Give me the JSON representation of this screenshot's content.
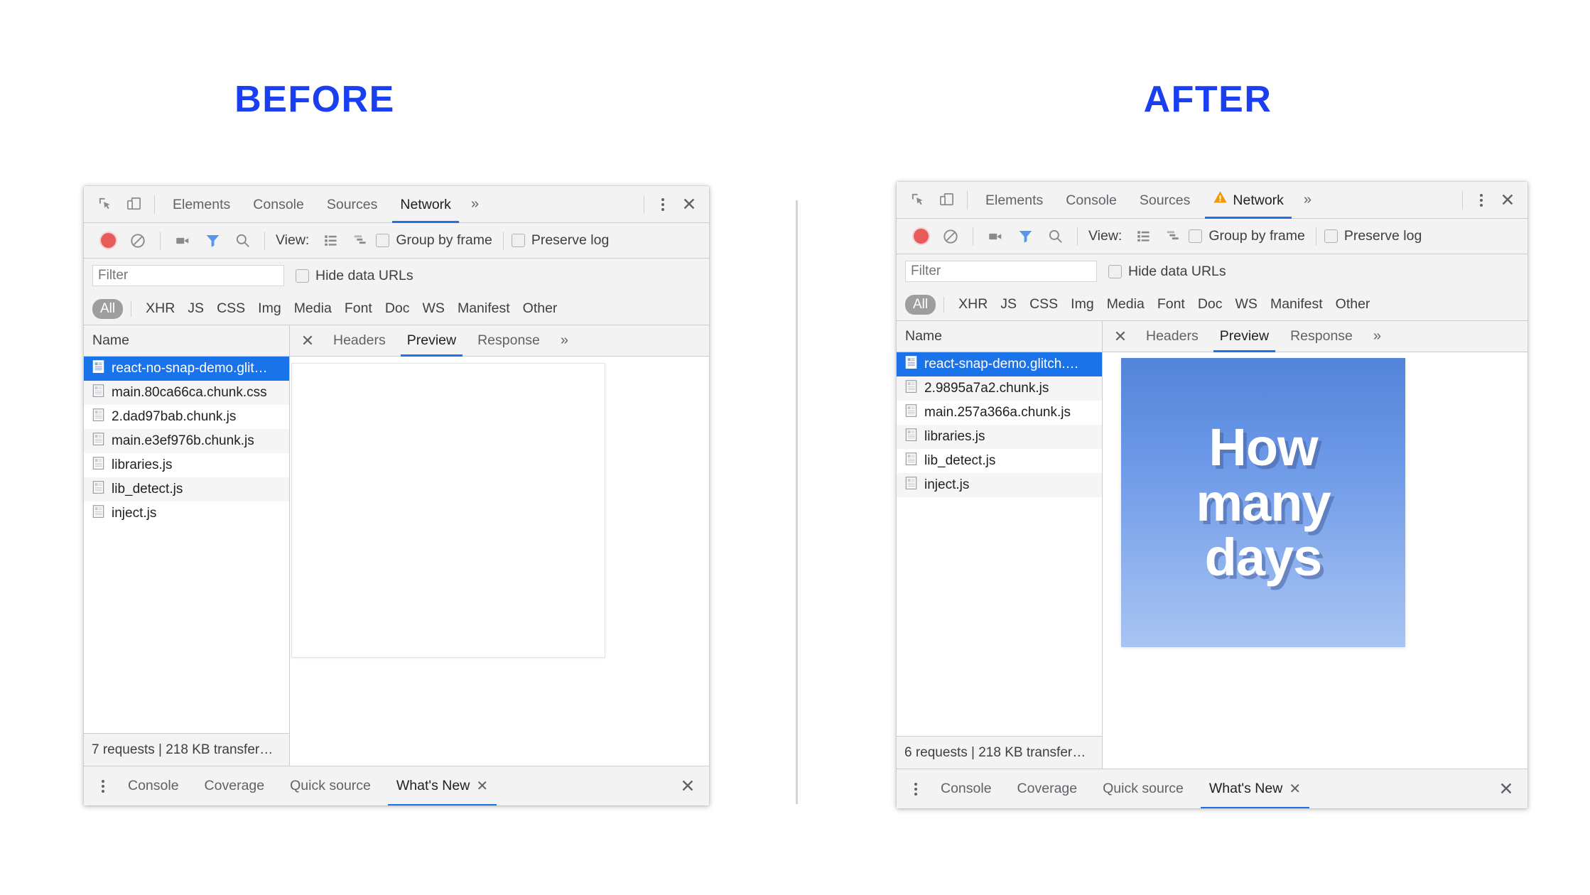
{
  "headings": {
    "before": "BEFORE",
    "after": "AFTER",
    "color": "#1a3ff0"
  },
  "accent": {
    "tab_underline": "#1a73e8",
    "selection_blue": "#1a73e8",
    "record_red": "#e52222",
    "filter_blue": "#1a73e8",
    "warning_orange": "#f29900"
  },
  "before": {
    "main_tabs": [
      {
        "label": "Elements",
        "active": false,
        "warning": false
      },
      {
        "label": "Console",
        "active": false,
        "warning": false
      },
      {
        "label": "Sources",
        "active": false,
        "warning": false
      },
      {
        "label": "Network",
        "active": true,
        "warning": false
      }
    ],
    "tab_overflow": "»",
    "icons": {
      "inspect": "inspect-element-icon",
      "device": "device-toolbar-icon",
      "record": "record-icon",
      "clear": "clear-icon",
      "camera": "screenshot-capture-icon",
      "filter": "filter-funnel-icon",
      "search": "search-icon",
      "view_list": "view-list-icon",
      "view_waterfall": "view-waterfall-icon",
      "kebab": "more-options-icon",
      "close": "close-icon"
    },
    "toolbar": {
      "view_label": "View:",
      "group_by_frame": "Group by frame",
      "preserve_log": "Preserve log"
    },
    "filter": {
      "placeholder": "Filter",
      "value": "",
      "hide_data_urls": "Hide data URLs"
    },
    "type_filters": {
      "all": "All",
      "items": [
        "XHR",
        "JS",
        "CSS",
        "Img",
        "Media",
        "Font",
        "Doc",
        "WS",
        "Manifest",
        "Other"
      ]
    },
    "requests": {
      "column_header": "Name",
      "rows": [
        {
          "name": "react-no-snap-demo.glit…",
          "selected": true
        },
        {
          "name": "main.80ca66ca.chunk.css",
          "selected": false
        },
        {
          "name": "2.dad97bab.chunk.js",
          "selected": false
        },
        {
          "name": "main.e3ef976b.chunk.js",
          "selected": false
        },
        {
          "name": "libraries.js",
          "selected": false
        },
        {
          "name": "lib_detect.js",
          "selected": false
        },
        {
          "name": "inject.js",
          "selected": false
        }
      ]
    },
    "summary": "7 requests | 218 KB transfer…",
    "detail_tabs": [
      {
        "label": "Headers",
        "active": false
      },
      {
        "label": "Preview",
        "active": true
      },
      {
        "label": "Response",
        "active": false
      }
    ],
    "detail_overflow": "»",
    "preview": {
      "kind": "blank",
      "lines": []
    },
    "drawer_tabs": [
      {
        "label": "Console",
        "active": false,
        "closable": false
      },
      {
        "label": "Coverage",
        "active": false,
        "closable": false
      },
      {
        "label": "Quick source",
        "active": false,
        "closable": false
      },
      {
        "label": "What's New",
        "active": true,
        "closable": true
      }
    ]
  },
  "after": {
    "main_tabs": [
      {
        "label": "Elements",
        "active": false,
        "warning": false
      },
      {
        "label": "Console",
        "active": false,
        "warning": false
      },
      {
        "label": "Sources",
        "active": false,
        "warning": false
      },
      {
        "label": "Network",
        "active": true,
        "warning": true
      }
    ],
    "tab_overflow": "»",
    "icons": {
      "inspect": "inspect-element-icon",
      "device": "device-toolbar-icon",
      "record": "record-icon",
      "clear": "clear-icon",
      "camera": "screenshot-capture-icon",
      "filter": "filter-funnel-icon",
      "search": "search-icon",
      "view_list": "view-list-icon",
      "view_waterfall": "view-waterfall-icon",
      "kebab": "more-options-icon",
      "close": "close-icon",
      "warning": "warning-triangle-icon"
    },
    "toolbar": {
      "view_label": "View:",
      "group_by_frame": "Group by frame",
      "preserve_log": "Preserve log"
    },
    "filter": {
      "placeholder": "Filter",
      "value": "",
      "hide_data_urls": "Hide data URLs"
    },
    "type_filters": {
      "all": "All",
      "items": [
        "XHR",
        "JS",
        "CSS",
        "Img",
        "Media",
        "Font",
        "Doc",
        "WS",
        "Manifest",
        "Other"
      ]
    },
    "requests": {
      "column_header": "Name",
      "rows": [
        {
          "name": "react-snap-demo.glitch.…",
          "selected": true
        },
        {
          "name": "2.9895a7a2.chunk.js",
          "selected": false
        },
        {
          "name": "main.257a366a.chunk.js",
          "selected": false
        },
        {
          "name": "libraries.js",
          "selected": false
        },
        {
          "name": "lib_detect.js",
          "selected": false
        },
        {
          "name": "inject.js",
          "selected": false
        }
      ]
    },
    "summary": "6 requests | 218 KB transfer…",
    "detail_tabs": [
      {
        "label": "Headers",
        "active": false
      },
      {
        "label": "Preview",
        "active": true
      },
      {
        "label": "Response",
        "active": false
      }
    ],
    "detail_overflow": "»",
    "preview": {
      "kind": "rendered",
      "lines": [
        "How",
        "many",
        "days"
      ],
      "text_color": "#ffffff",
      "bg_gradient_top": "#5384d8",
      "bg_gradient_bottom": "#a8c4f2"
    },
    "drawer_tabs": [
      {
        "label": "Console",
        "active": false,
        "closable": false
      },
      {
        "label": "Coverage",
        "active": false,
        "closable": false
      },
      {
        "label": "Quick source",
        "active": false,
        "closable": false
      },
      {
        "label": "What's New",
        "active": true,
        "closable": true
      }
    ]
  }
}
